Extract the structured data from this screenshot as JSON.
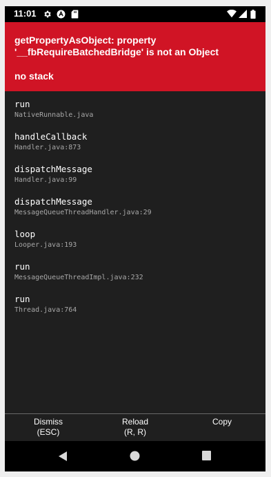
{
  "status_bar": {
    "time": "11:01",
    "icons_left": [
      "gear-icon",
      "app-indicator-icon",
      "sd-card-icon"
    ],
    "icons_right": [
      "wifi-icon",
      "cell-signal-icon",
      "battery-icon"
    ]
  },
  "error": {
    "message": "getPropertyAsObject: property '__fbRequireBatchedBridge' is not an Object",
    "stack_note": "no stack",
    "header_color": "#d01425"
  },
  "stack_frames": [
    {
      "method": "run",
      "file": "NativeRunnable.java"
    },
    {
      "method": "handleCallback",
      "file": "Handler.java:873"
    },
    {
      "method": "dispatchMessage",
      "file": "Handler.java:99"
    },
    {
      "method": "dispatchMessage",
      "file": "MessageQueueThreadHandler.java:29"
    },
    {
      "method": "loop",
      "file": "Looper.java:193"
    },
    {
      "method": "run",
      "file": "MessageQueueThreadImpl.java:232"
    },
    {
      "method": "run",
      "file": "Thread.java:764"
    }
  ],
  "buttons": {
    "dismiss": {
      "line1": "Dismiss",
      "line2": "(ESC)"
    },
    "reload": {
      "line1": "Reload",
      "line2": "(R, R)"
    },
    "copy": {
      "line1": "Copy",
      "line2": ""
    }
  },
  "nav_bar": {
    "icons": [
      "back-icon",
      "home-icon",
      "recents-icon"
    ]
  }
}
